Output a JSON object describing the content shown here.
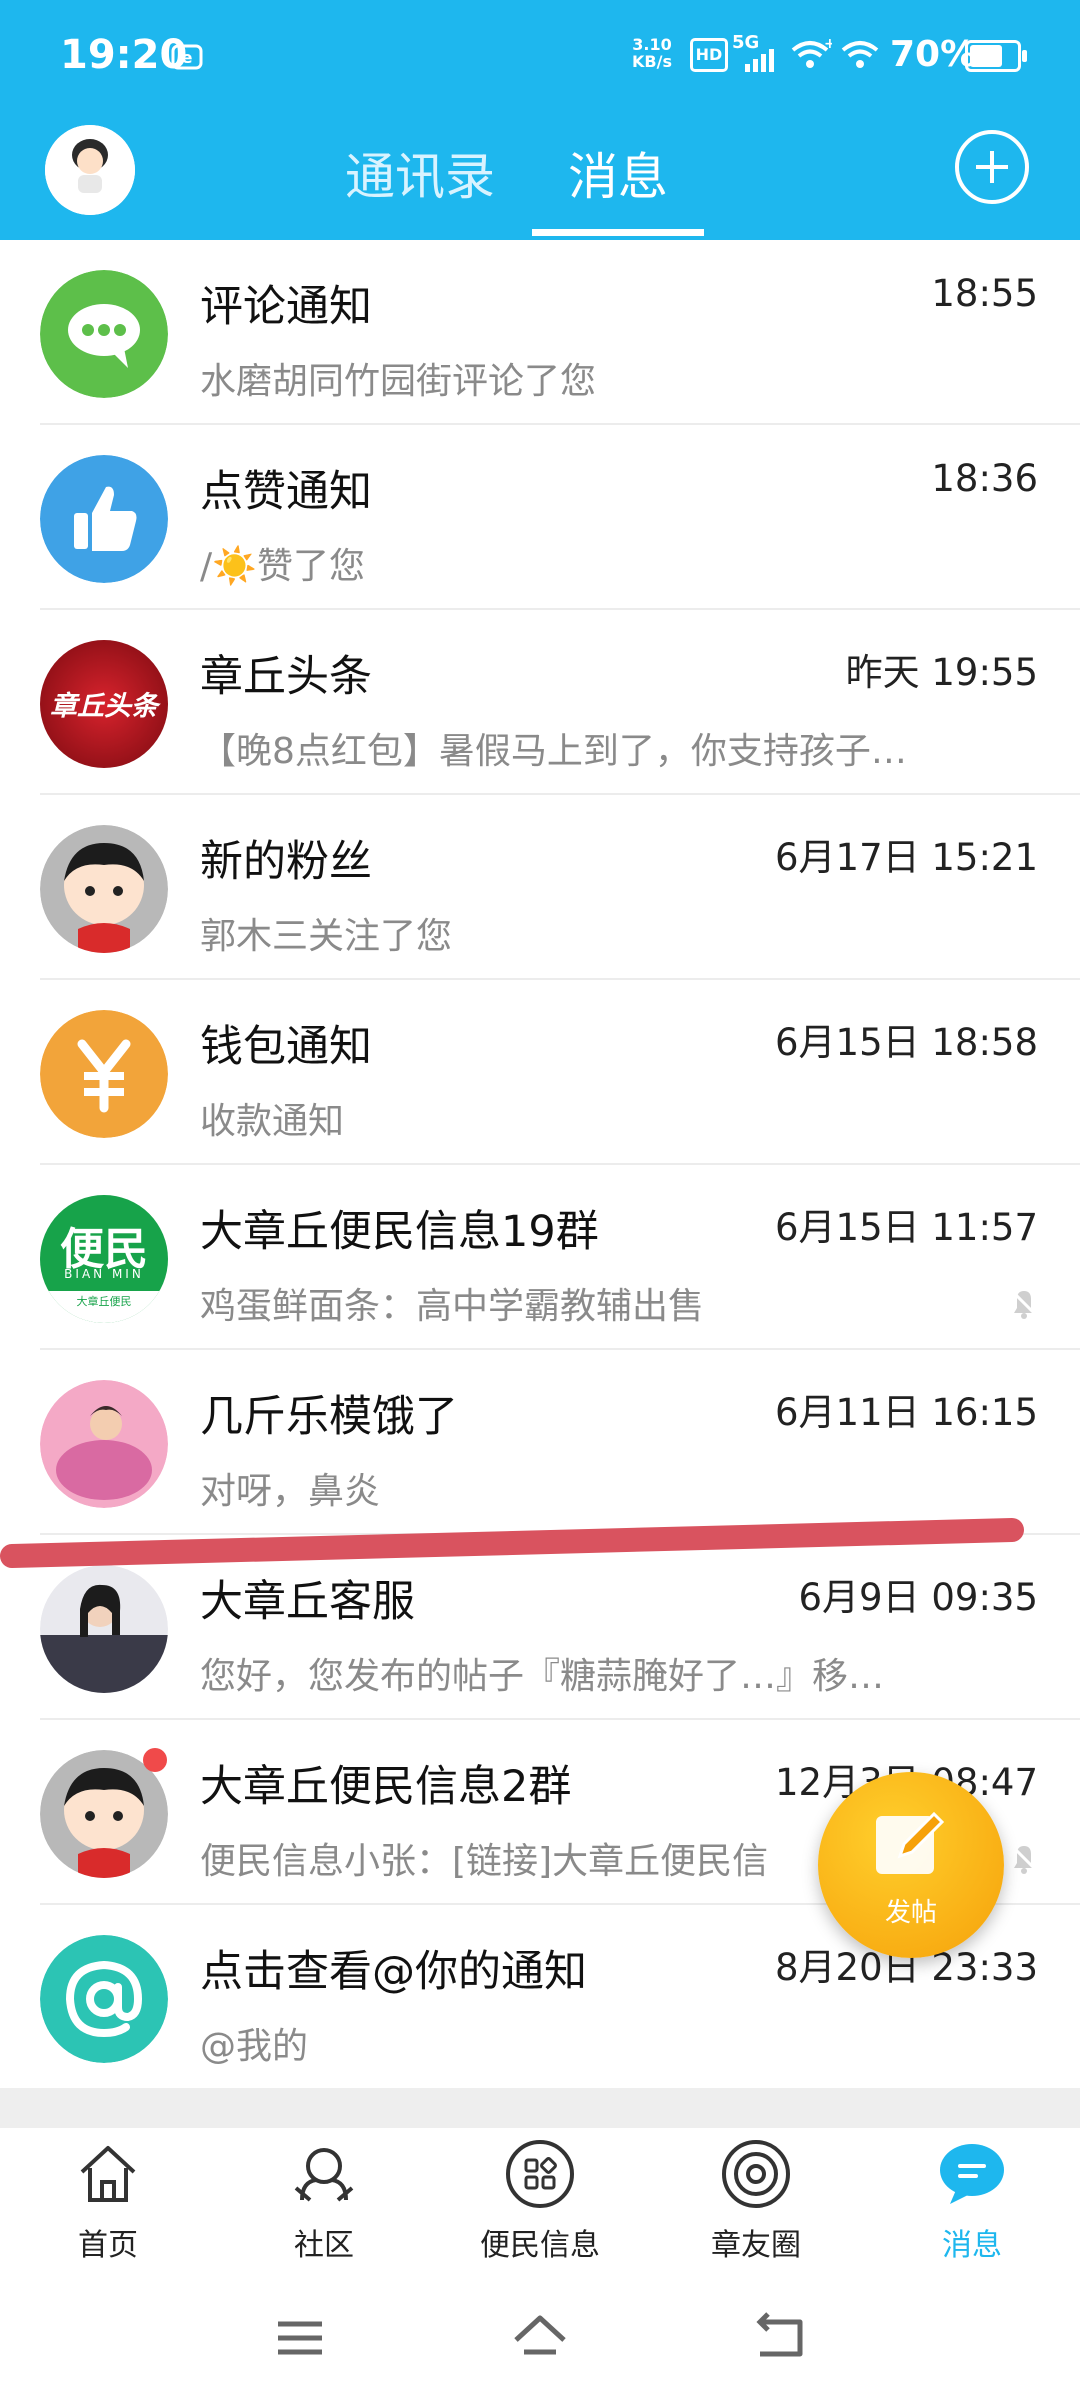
{
  "status_bar": {
    "time": "19:20",
    "net_speed": "3.10 KB/s",
    "network": "5G",
    "battery": "70%",
    "battery_level": 0.7
  },
  "header": {
    "tabs": [
      "通讯录",
      "消息"
    ],
    "active_tab": "消息"
  },
  "messages": [
    {
      "title": "评论通知",
      "preview": "水磨胡同竹园街评论了您",
      "time": "18:55",
      "icon": "comment-icon",
      "color": "#5dbf4a"
    },
    {
      "title": "点赞通知",
      "preview": "/☀️赞了您",
      "time": "18:36",
      "icon": "thumbs-up-icon",
      "color": "#3fa2e6"
    },
    {
      "title": "章丘头条",
      "preview": "【晚8点红包】暑假马上到了，你支持孩子…",
      "time": "昨天 19:55",
      "icon": "zhangqiu-toutiao-logo",
      "avatar_text": "章丘头条",
      "color": "#b5121b"
    },
    {
      "title": "新的粉丝",
      "preview": "郭木三关注了您",
      "time": "6月17日 15:21",
      "icon": "cartoon-avatar",
      "color": "#b8b8b8"
    },
    {
      "title": "钱包通知",
      "preview": "收款通知",
      "time": "6月15日 18:58",
      "icon": "yuan-icon",
      "color": "#f2a43a"
    },
    {
      "title": "大章丘便民信息19群",
      "preview": "鸡蛋鲜面条：高中学霸教辅出售",
      "time": "6月15日 11:57",
      "icon": "bianmin-logo",
      "avatar_text": "便民",
      "avatar_sub": "BIAN MIN",
      "avatar_foot": "大章丘便民",
      "color": "#17a34a",
      "muted": true
    },
    {
      "title": "几斤乐模饿了",
      "preview": "对呀，鼻炎",
      "time": "6月11日 16:15",
      "icon": "photo-avatar-pink",
      "color": "#e07aa8"
    },
    {
      "title": "大章丘客服",
      "preview": "您好，您发布的帖子『糖蒜腌好了…』移…",
      "time": "6月9日 09:35",
      "icon": "photo-avatar-person",
      "color": "#3a3a48"
    },
    {
      "title": "大章丘便民信息2群",
      "preview": "便民信息小张：[链接]大章丘便民信",
      "time": "12月3日 08:47",
      "icon": "cartoon-avatar",
      "color": "#b8b8b8",
      "muted": true,
      "unread_dot": true
    },
    {
      "title": "点击查看@你的通知",
      "preview": "@我的",
      "time": "8月20日 23:33",
      "icon": "at-icon",
      "color": "#2cc4b4"
    }
  ],
  "fab": {
    "label": "发帖",
    "icon": "edit-icon"
  },
  "bottom_nav": [
    {
      "label": "首页",
      "icon": "home-icon"
    },
    {
      "label": "社区",
      "icon": "community-icon"
    },
    {
      "label": "便民信息",
      "icon": "apps-icon"
    },
    {
      "label": "章友圈",
      "icon": "orbit-icon"
    },
    {
      "label": "消息",
      "icon": "message-icon",
      "active": true
    }
  ],
  "colors": {
    "accent": "#1eb7ee",
    "fab": "#f6a10a",
    "annotation": "#d9535f"
  }
}
